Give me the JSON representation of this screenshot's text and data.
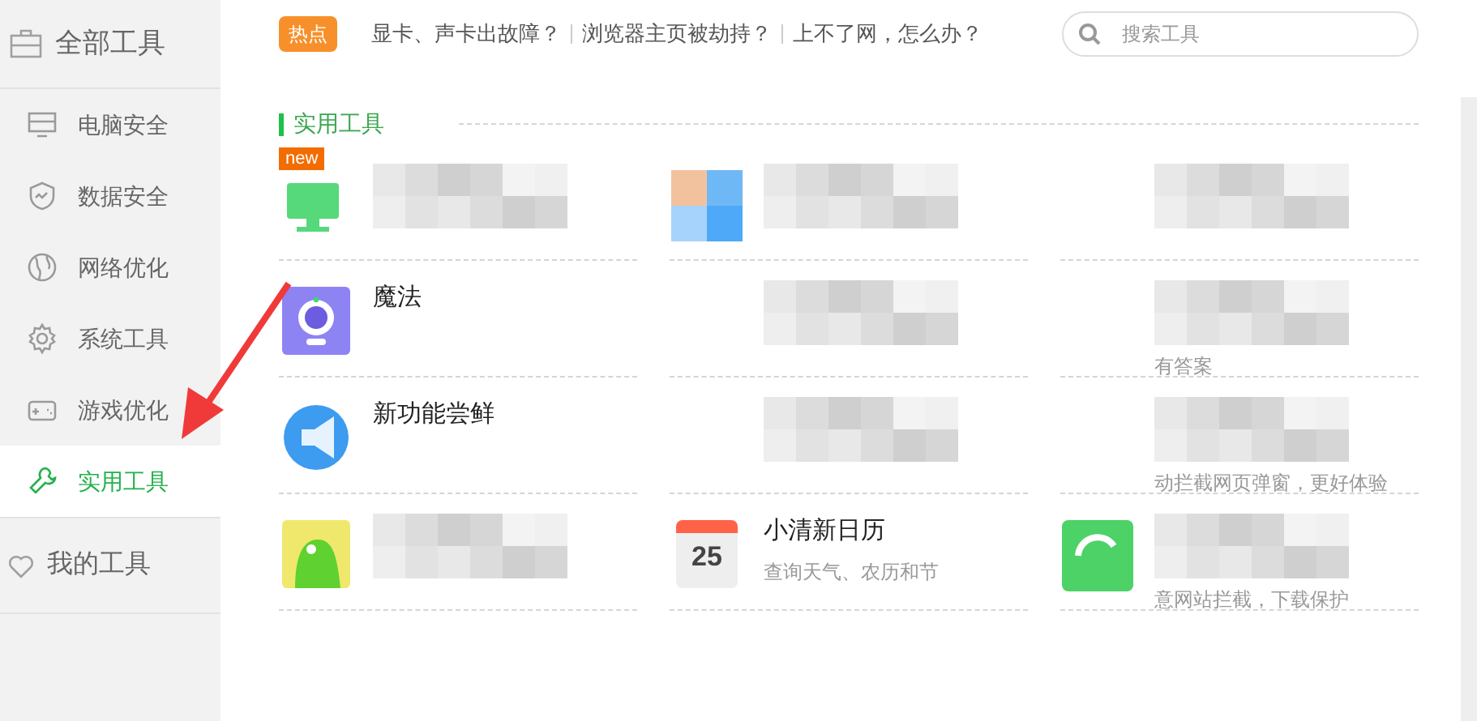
{
  "sidebar": {
    "header": "全部工具",
    "items": [
      {
        "label": "电脑安全",
        "selected": false
      },
      {
        "label": "数据安全",
        "selected": false
      },
      {
        "label": "网络优化",
        "selected": false
      },
      {
        "label": "系统工具",
        "selected": false
      },
      {
        "label": "游戏优化",
        "selected": false
      },
      {
        "label": "实用工具",
        "selected": true
      }
    ],
    "footer": "我的工具"
  },
  "hot": {
    "badge": "热点",
    "links": [
      "显卡、声卡出故障？",
      "浏览器主页被劫持？",
      "上不了网，怎么办？"
    ]
  },
  "search": {
    "placeholder": "搜索工具"
  },
  "section": {
    "title": "实用工具"
  },
  "cards": [
    {
      "kind": "monitor",
      "badge": "new"
    },
    {
      "kind": "tile"
    },
    {
      "kind": "blank"
    },
    {
      "kind": "camera",
      "name": "魔法"
    },
    {
      "kind": "blank"
    },
    {
      "kind": "blank",
      "desc": "有答案"
    },
    {
      "kind": "megaphone",
      "name": "新功能尝鲜"
    },
    {
      "kind": "blank"
    },
    {
      "kind": "blank",
      "desc": "动拦截网页弹窗，更好体验"
    },
    {
      "kind": "monster"
    },
    {
      "kind": "calendar",
      "icon_text": "25",
      "name": "小清新日历",
      "desc": "查询天气、农历和节"
    },
    {
      "kind": "app",
      "desc": "意网站拦截，下载保护"
    }
  ]
}
